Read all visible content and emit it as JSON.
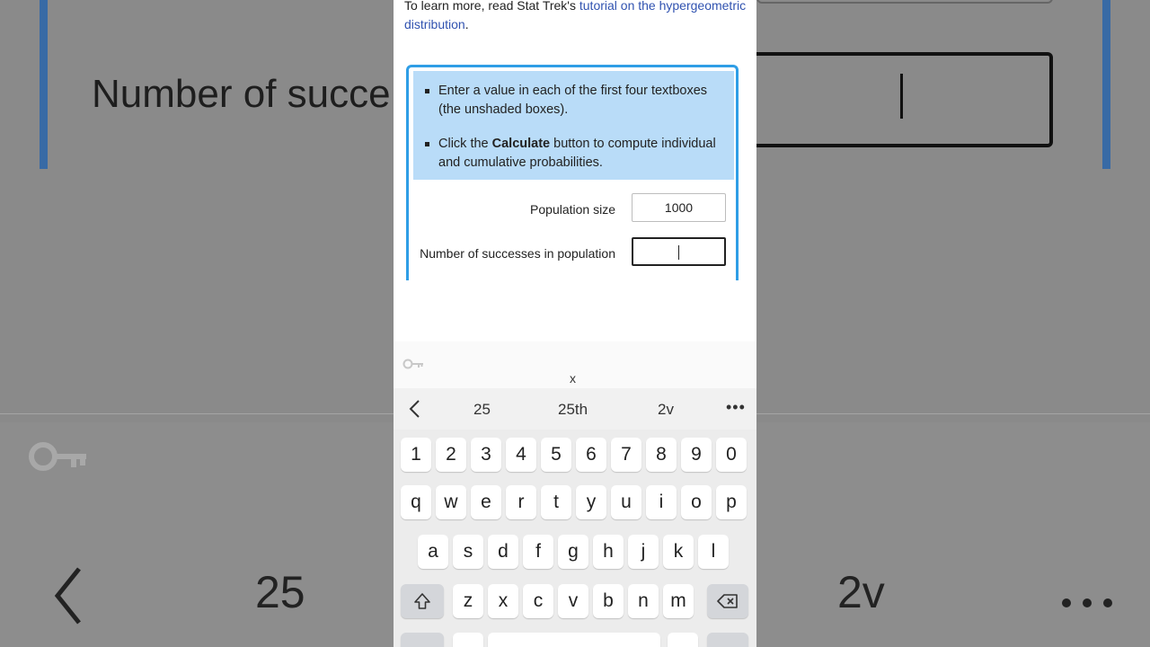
{
  "background": {
    "field_label": "Number of succe",
    "suggestions": [
      "25",
      "2v"
    ]
  },
  "intro": {
    "prefix": "To learn more, read Stat Trek's ",
    "link": "tutorial on the hypergeometric distribution",
    "suffix": "."
  },
  "instructions": {
    "item1": "Enter a value in each of the first four textboxes (the unshaded boxes).",
    "item2_before": "Click the ",
    "item2_bold": "Calculate",
    "item2_after": " button to compute individual and cumulative probabilities."
  },
  "form": {
    "population_size_label": "Population size",
    "population_size_value": "1000",
    "successes_label": "Number of successes in population",
    "successes_value": ""
  },
  "keyboard": {
    "close_label": "x",
    "suggestions": [
      "25",
      "25th",
      "2v"
    ],
    "more_label": "•••",
    "number_row": [
      "1",
      "2",
      "3",
      "4",
      "5",
      "6",
      "7",
      "8",
      "9",
      "0"
    ],
    "row1": [
      "q",
      "w",
      "e",
      "r",
      "t",
      "y",
      "u",
      "i",
      "o",
      "p"
    ],
    "row2": [
      "a",
      "s",
      "d",
      "f",
      "g",
      "h",
      "j",
      "k",
      "l"
    ],
    "row3": [
      "z",
      "x",
      "c",
      "v",
      "b",
      "n",
      "m"
    ]
  },
  "colors": {
    "accent_border": "#2f9ee6",
    "instruction_bg": "#b9dcf8",
    "link": "#3153b0"
  }
}
